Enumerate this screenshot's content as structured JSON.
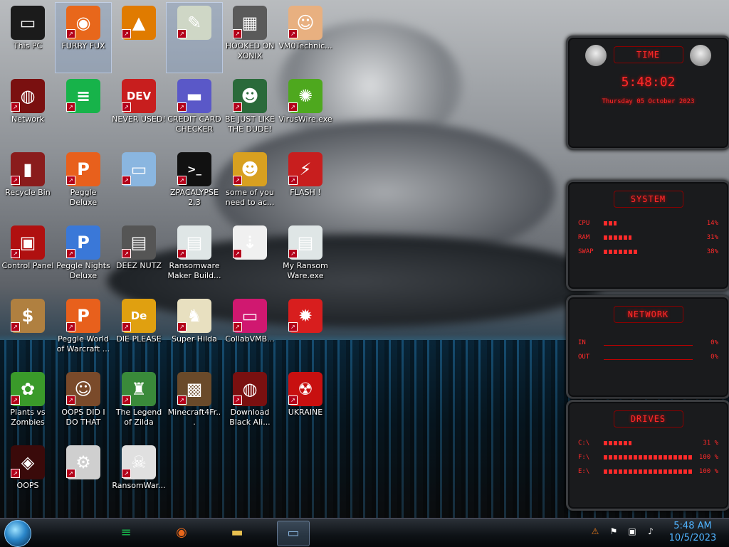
{
  "desktop": {
    "icons": [
      {
        "label": "This PC",
        "glyph": "▭",
        "icon": "this-pc-icon",
        "color": "#1b1b1b"
      },
      {
        "label": "FURRY FUX",
        "glyph": "◉",
        "icon": "firefox-icon",
        "color": "#e8671b",
        "selected": true
      },
      {
        "label": "",
        "glyph": "▲",
        "icon": "vlc-icon",
        "color": "#e07b00"
      },
      {
        "label": "",
        "glyph": "✎",
        "icon": "hex-editor-icon",
        "color": "#cfd7c6",
        "selected": true
      },
      {
        "label": "HOOKED ON XONIX",
        "glyph": "▦",
        "icon": "xonix-icon",
        "color": "#5a5a5a"
      },
      {
        "label": "VM0Technic...",
        "glyph": "☺",
        "icon": "doctor-icon",
        "color": "#e8b080"
      },
      {
        "label": "Network",
        "glyph": "◍",
        "icon": "network-icon",
        "color": "#7a1010"
      },
      {
        "label": "",
        "glyph": "≡",
        "icon": "spotify-icon",
        "color": "#17b34a"
      },
      {
        "label": "NEVER USED!",
        "glyph": "DEV",
        "icon": "dev-cpp-icon",
        "color": "#c81e1e"
      },
      {
        "label": "CREDIT CARD CHECKER",
        "glyph": "▬",
        "icon": "credit-card-icon",
        "color": "#5a58c8"
      },
      {
        "label": "BE JUST LIKE THE DUDE!",
        "glyph": "☻",
        "icon": "elf-icon",
        "color": "#2a6a3a"
      },
      {
        "label": "VirusWire.exe",
        "glyph": "✺",
        "icon": "limewire-icon",
        "color": "#4ea81e"
      },
      {
        "label": "Recycle Bin",
        "glyph": "▮",
        "icon": "recycle-bin-icon",
        "color": "#8a1c1c"
      },
      {
        "label": "Peggle Deluxe",
        "glyph": "P",
        "icon": "peggle-icon",
        "color": "#e8601c"
      },
      {
        "label": "",
        "glyph": "▭",
        "icon": "spy-pc-icon",
        "color": "#8ab6e0"
      },
      {
        "label": "ZPACALYPSE 2.3",
        "glyph": ">_",
        "icon": "terminal-icon",
        "color": "#111111"
      },
      {
        "label": "some of you need to ac...",
        "glyph": "☻",
        "icon": "dog-icon",
        "color": "#d8a020"
      },
      {
        "label": "FLASH !",
        "glyph": "⚡",
        "icon": "flash-icon",
        "color": "#c81e1e"
      },
      {
        "label": "Control Panel",
        "glyph": "▣",
        "icon": "control-panel-icon",
        "color": "#b01010"
      },
      {
        "label": "Peggle Nights Deluxe",
        "glyph": "P",
        "icon": "peggle-nights-icon",
        "color": "#3a78d8"
      },
      {
        "label": "DEEZ NUTZ",
        "glyph": "▤",
        "icon": "stacked-windows-icon",
        "color": "#555555"
      },
      {
        "label": "Ransomware Maker Build...",
        "glyph": "▤",
        "icon": "program-window-icon",
        "color": "#dfe6e6"
      },
      {
        "label": "",
        "glyph": "⇣",
        "icon": "arrows-icon",
        "color": "#f0f0f0"
      },
      {
        "label": "My Ransom Ware.exe",
        "glyph": "▤",
        "icon": "program-window-icon-2",
        "color": "#dfe6e6"
      },
      {
        "label": "",
        "glyph": "$",
        "icon": "money-bag-icon",
        "color": "#b08040"
      },
      {
        "label": "Peggle World of Warcraft ...",
        "glyph": "P",
        "icon": "peggle-wow-icon",
        "color": "#e8601c"
      },
      {
        "label": "DIE PLEASE",
        "glyph": "De",
        "icon": "de-icon",
        "color": "#e0a010"
      },
      {
        "label": "Super Hilda",
        "glyph": "♞",
        "icon": "pixel-dog-icon",
        "color": "#e8e0c0"
      },
      {
        "label": "CollabVMB...",
        "glyph": "▭",
        "icon": "monitor-icon",
        "color": "#d01870"
      },
      {
        "label": "",
        "glyph": "✹",
        "icon": "chuzzle-icon",
        "color": "#d81e1e"
      },
      {
        "label": "Plants vs Zombies",
        "glyph": "✿",
        "icon": "pvz-icon",
        "color": "#3a9a2a"
      },
      {
        "label": "OOPS DID I DO THAT",
        "glyph": "☺",
        "icon": "portrait-icon",
        "color": "#7a4a2a"
      },
      {
        "label": "The Legend of Zilda",
        "glyph": "♜",
        "icon": "zelda-icon",
        "color": "#3a8a3a"
      },
      {
        "label": "Minecraft4Fr...",
        "glyph": "▩",
        "icon": "minecraft-icon",
        "color": "#6a4a2a"
      },
      {
        "label": "Download Black Ali...",
        "glyph": "◍",
        "icon": "alienware-icon",
        "color": "#7a1010"
      },
      {
        "label": "UKRAINE",
        "glyph": "☢",
        "icon": "radiation-icon",
        "color": "#c81010"
      },
      {
        "label": "OOPS",
        "glyph": "◈",
        "icon": "dark-app-icon",
        "color": "#3a0a0a"
      },
      {
        "label": "",
        "glyph": "⚙",
        "icon": "gear-flag-icon",
        "color": "#cfcfcf"
      },
      {
        "label": "RansomWar...",
        "glyph": "☠",
        "icon": "skull-icon",
        "color": "#e0e0e0"
      }
    ]
  },
  "widgets": {
    "time": {
      "title": "TIME",
      "clock": "5:48:02",
      "date": "Thursday 05 October 2023"
    },
    "system": {
      "title": "SYSTEM",
      "rows": [
        {
          "label": "CPU",
          "value": "14%",
          "level": 0.14
        },
        {
          "label": "RAM",
          "value": "31%",
          "level": 0.31
        },
        {
          "label": "SWAP",
          "value": "38%",
          "level": 0.38
        }
      ]
    },
    "network": {
      "title": "NETWORK",
      "rows": [
        {
          "label": "IN",
          "value": "0%"
        },
        {
          "label": "OUT",
          "value": "0%"
        }
      ]
    },
    "drives": {
      "title": "DRIVES",
      "rows": [
        {
          "label": "C:\\",
          "value": "31 %",
          "level": 0.31
        },
        {
          "label": "F:\\",
          "value": "100 %",
          "level": 1.0
        },
        {
          "label": "E:\\",
          "value": "100 %",
          "level": 1.0
        }
      ]
    }
  },
  "taskbar": {
    "apps": [
      {
        "name": "spotify",
        "glyph": "≡",
        "icon": "spotify-icon",
        "color": "#17b34a"
      },
      {
        "name": "firefox",
        "glyph": "◉",
        "icon": "firefox-icon",
        "color": "#e8671b"
      },
      {
        "name": "file-explorer",
        "glyph": "▬",
        "icon": "folder-icon",
        "color": "#e8c050"
      },
      {
        "name": "control-panel",
        "glyph": "▭",
        "icon": "monitor-icon",
        "color": "#8ab6e0",
        "active": true
      }
    ],
    "tray": [
      {
        "glyph": "⚠",
        "icon": "update-icon",
        "color": "#e87a1c"
      },
      {
        "glyph": "⚑",
        "icon": "action-center-icon",
        "color": "#ffffff"
      },
      {
        "glyph": "▣",
        "icon": "network-tray-icon",
        "color": "#ffffff"
      },
      {
        "glyph": "♪",
        "icon": "volume-icon",
        "color": "#ffffff"
      }
    ],
    "time": "5:48 AM",
    "date": "10/5/2023"
  }
}
